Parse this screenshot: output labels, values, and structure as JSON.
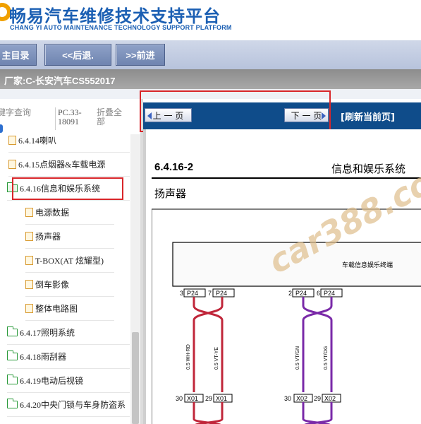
{
  "header": {
    "title": "畅易汽车维修技术支持平台",
    "subtitle": "CHANG YI AUTO MAINTENANCE TECHNOLOGY SUPPORT PLATFORM"
  },
  "nav": {
    "main_label": "主目录",
    "back_label": "<<后退.",
    "forward_label": ">>前进"
  },
  "manufacturer": "厂家:C-长安汽车CS552017",
  "tabs": {
    "keyword": "键字查询",
    "code": "PC.33-18091",
    "collapse": "折叠全部"
  },
  "tree": {
    "items": [
      {
        "label": "6.4.14喇叭",
        "kind": "file",
        "level": 1
      },
      {
        "label": "6.4.15点烟器&车载电源",
        "kind": "file",
        "level": 1
      },
      {
        "label": "6.4.16信息和娱乐系统",
        "kind": "folder-open",
        "level": 1,
        "selected": true
      },
      {
        "label": "电源数据",
        "kind": "file",
        "level": 2
      },
      {
        "label": "扬声器",
        "kind": "file",
        "level": 2
      },
      {
        "label": "T-BOX(AT 炫耀型)",
        "kind": "file",
        "level": 2
      },
      {
        "label": "倒车影像",
        "kind": "file",
        "level": 2
      },
      {
        "label": "整体电路图",
        "kind": "file",
        "level": 2
      },
      {
        "label": "6.4.17照明系统",
        "kind": "folder",
        "level": 1
      },
      {
        "label": "6.4.18雨刮器",
        "kind": "folder",
        "level": 1
      },
      {
        "label": "6.4.19电动后视镜",
        "kind": "folder",
        "level": 1
      },
      {
        "label": "6.4.20中央门锁与车身防盗系",
        "kind": "folder",
        "level": 1
      }
    ]
  },
  "content_toolbar": {
    "prev_label": "上 一 页",
    "next_label": "下 一 页",
    "refresh_label": "[刷新当前页]"
  },
  "doc": {
    "section_number": "6.4.16-2",
    "section_title": "信息和娱乐系统",
    "subtitle": "扬声器",
    "module_label": "车载信息娱乐终端",
    "pins_top": [
      {
        "pin": "3",
        "code": "P24"
      },
      {
        "pin": "7",
        "code": "P24"
      },
      {
        "pin": "2",
        "code": "P24"
      },
      {
        "pin": "6",
        "code": "P24"
      }
    ],
    "wires": [
      "0.5 WH-RD",
      "0.5 VT-YE",
      "0.5 VT/GN",
      "0.5 VT/OG"
    ],
    "pins_bottom": [
      {
        "pin": "30",
        "code": "X01"
      },
      {
        "pin": "29",
        "code": "X01"
      },
      {
        "pin": "30",
        "code": "X02"
      },
      {
        "pin": "29",
        "code": "X02"
      }
    ],
    "watermark": "car388.com"
  },
  "colors": {
    "brand_blue": "#1b5fb3",
    "toolbar_blue": "#0f4c8a",
    "highlight_red": "#d8262a",
    "wire_red": "#c0263a",
    "wire_purple": "#7a2aa8"
  }
}
